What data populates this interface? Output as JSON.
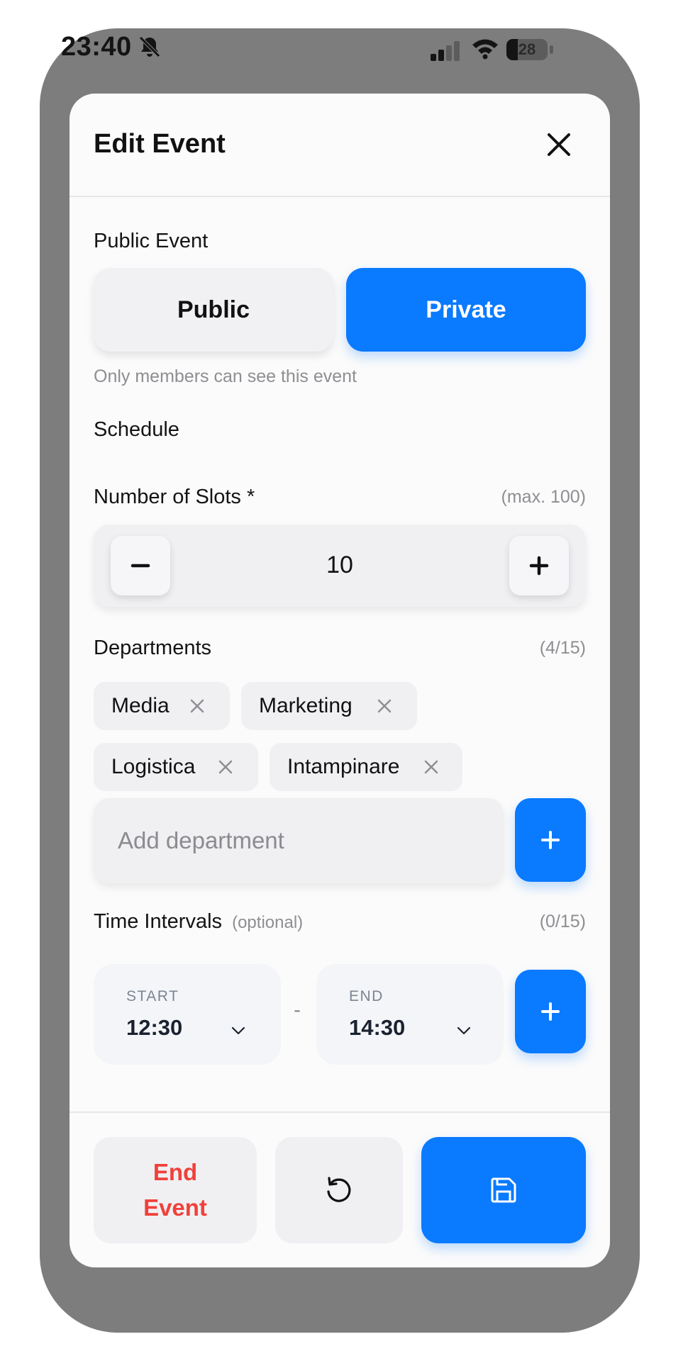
{
  "status_bar": {
    "time": "23:40",
    "battery": "28",
    "icons": [
      "bell-slash-icon",
      "signal-icon",
      "wifi-icon",
      "battery-icon"
    ]
  },
  "modal": {
    "title": "Edit Event",
    "close_icon": "close-icon"
  },
  "visibility": {
    "label": "Public Event",
    "options": [
      "Public",
      "Private"
    ],
    "selected": "Private",
    "hint": "Only members can see this event"
  },
  "schedule": {
    "label": "Schedule"
  },
  "slots": {
    "label": "Number of Slots *",
    "max_hint": "(max. 100)",
    "value": "10"
  },
  "departments": {
    "label": "Departments",
    "count": "(4/15)",
    "items": [
      "Media",
      "Marketing",
      "Logistica",
      "Intampinare"
    ],
    "input_placeholder": "Add department"
  },
  "time_intervals": {
    "label": "Time Intervals",
    "optional": "(optional)",
    "count": "(0/15)",
    "start_label": "START",
    "start_value": "12:30",
    "separator": "-",
    "end_label": "END",
    "end_value": "14:30"
  },
  "footer": {
    "end_event_line1": "End",
    "end_event_line2": "Event",
    "reset_icon": "reset-icon",
    "save_icon": "save-icon"
  },
  "colors": {
    "accent": "#0a7aff",
    "danger": "#f0413a",
    "device_frame": "#7d7d7d"
  }
}
